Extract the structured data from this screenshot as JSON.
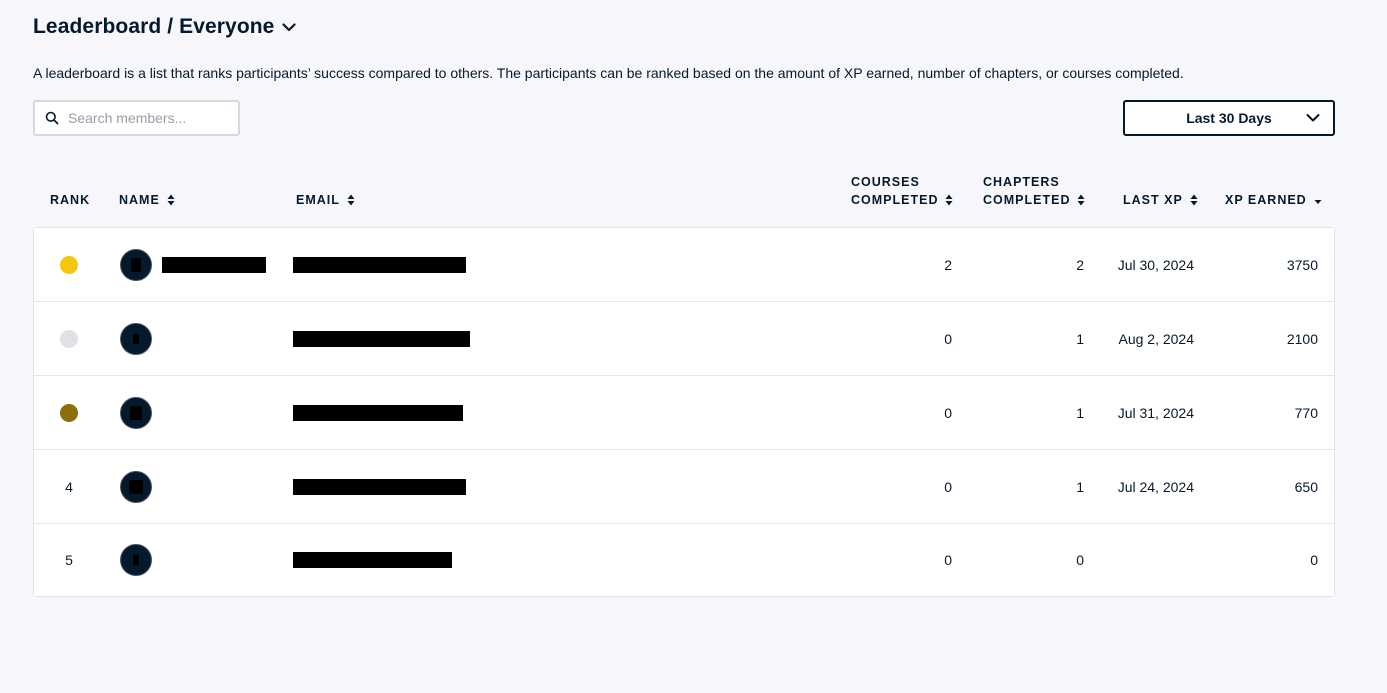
{
  "header": {
    "title": "Leaderboard / Everyone",
    "description": "A leaderboard is a list that ranks participants’ success compared to others. The participants can be ranked based on the amount of XP earned, number of chapters, or courses completed."
  },
  "search": {
    "placeholder": "Search members..."
  },
  "period": {
    "selected": "Last 30 Days"
  },
  "columns": {
    "rank": "RANK",
    "name": "NAME",
    "email": "EMAIL",
    "courses_line1": "COURSES",
    "courses_line2": "COMPLETED",
    "chapters_line1": "CHAPTERS",
    "chapters_line2": "COMPLETED",
    "last_xp": "LAST XP",
    "xp_earned": "XP EARNED"
  },
  "colors": {
    "gold": "#f5c70a",
    "silver": "#e0e1e6",
    "bronze": "#8e6d0b",
    "text": "#05192d"
  },
  "rows": [
    {
      "rank": "",
      "medal": "gold",
      "courses": "2",
      "chapters": "2",
      "last_xp": "Jul 30, 2024",
      "xp": "3750"
    },
    {
      "rank": "",
      "medal": "silver",
      "courses": "0",
      "chapters": "1",
      "last_xp": "Aug 2, 2024",
      "xp": "2100"
    },
    {
      "rank": "",
      "medal": "bronze",
      "courses": "0",
      "chapters": "1",
      "last_xp": "Jul 31, 2024",
      "xp": "770"
    },
    {
      "rank": "4",
      "medal": "",
      "courses": "0",
      "chapters": "1",
      "last_xp": "Jul 24, 2024",
      "xp": "650"
    },
    {
      "rank": "5",
      "medal": "",
      "courses": "0",
      "chapters": "0",
      "last_xp": "",
      "xp": "0"
    }
  ]
}
